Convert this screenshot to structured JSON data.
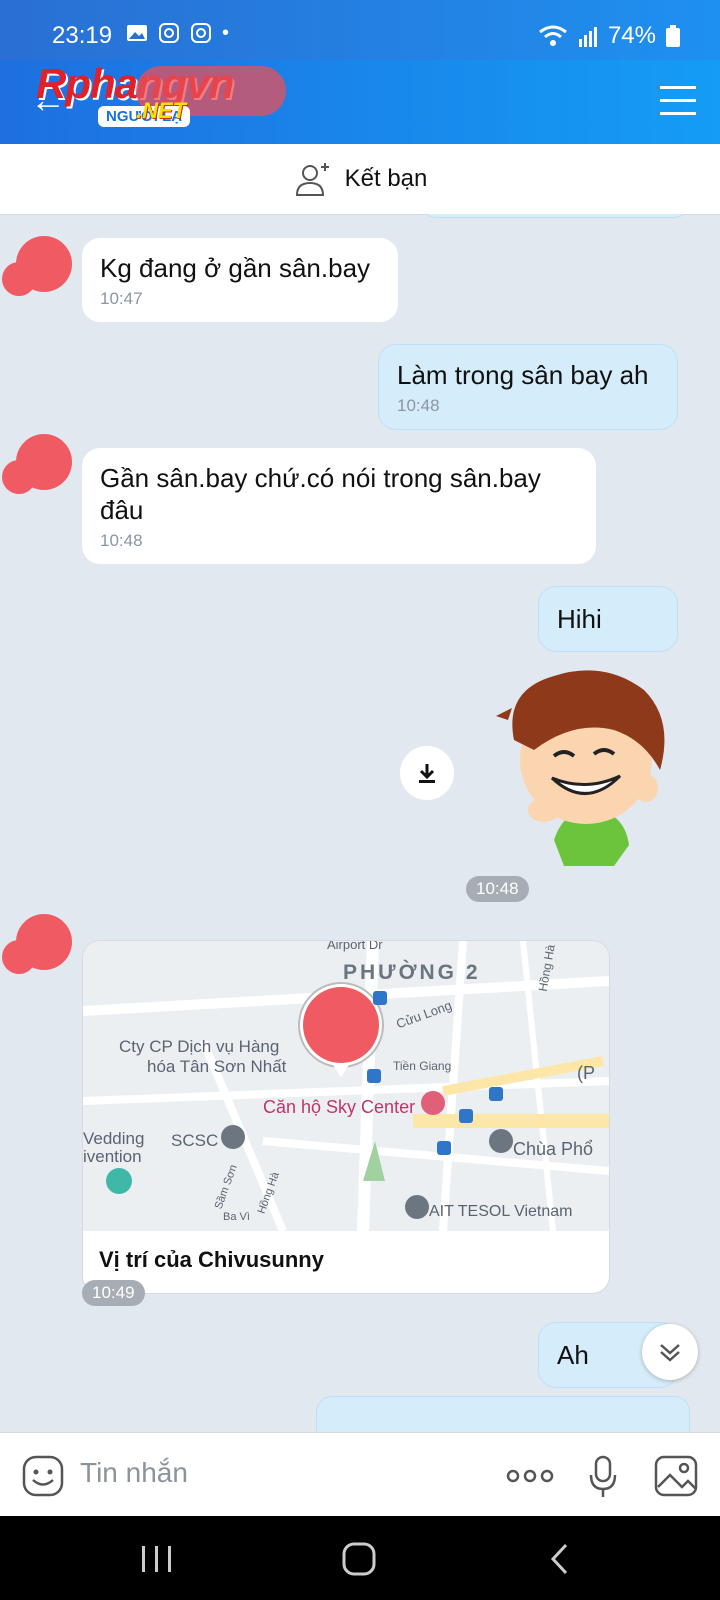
{
  "status_bar": {
    "time": "23:19",
    "battery": "74%"
  },
  "header": {
    "logo_text": "Rphangvn",
    "logo_net": ".NET",
    "logo_badge": "NGƯỜI LẠ"
  },
  "friend_bar": {
    "add_friend_label": "Kết bạn"
  },
  "messages": [
    {
      "from": "them",
      "text": "Kg đang ở gần sân.bay",
      "time": "10:47"
    },
    {
      "from": "me",
      "text": "Làm trong sân bay ah",
      "time": "10:48"
    },
    {
      "from": "them",
      "text": "Gần sân.bay chứ.có nói trong sân.bay đâu",
      "time": "10:48"
    },
    {
      "from": "me",
      "text": "Hihi",
      "time": ""
    },
    {
      "from": "me",
      "type": "sticker",
      "time": "10:48"
    },
    {
      "from": "them",
      "type": "location",
      "title": "Vị trí của Chivusunny",
      "time": "10:49"
    },
    {
      "from": "me",
      "text": "Ah",
      "time": ""
    }
  ],
  "map_labels": {
    "ward": "PHƯỜNG 2",
    "airport": "Airport Dr",
    "company": "Cty CP Dịch vụ Hàng",
    "company2": "hóa Tân Sơn Nhất",
    "sky_center": "Căn hộ Sky Center",
    "scsc": "SCSC",
    "wedding": "Vedding",
    "wedding2": "ivention",
    "cuu_long": "Cửu Long",
    "tien_giang": "Tiền Giang",
    "chua_pho": "Chùa Phổ",
    "ait": "AIT TESOL Vietnam",
    "sam_son": "Sầm Sơn",
    "hong_ha": "Hồng Hà",
    "ba_vi": "Ba Vì",
    "p": "(P"
  },
  "input": {
    "placeholder": "Tin nhắn"
  },
  "colors": {
    "accent": "#1e90f0",
    "bubble_out": "#d5ecfb",
    "bubble_in": "#ffffff"
  }
}
